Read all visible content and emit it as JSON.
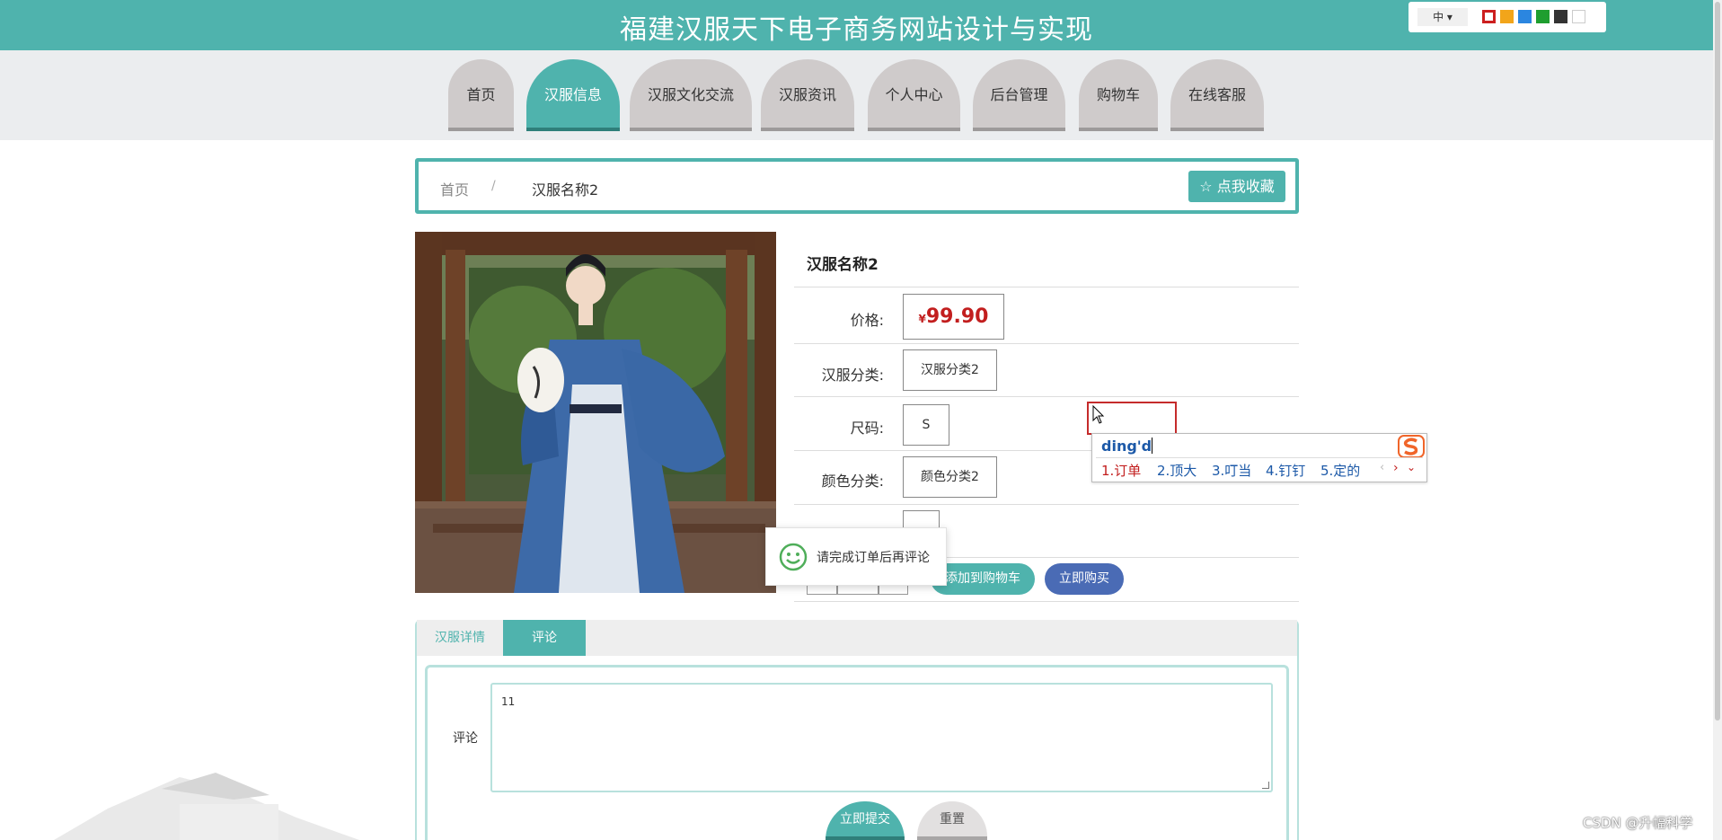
{
  "header": {
    "title": "福建汉服天下电子商务网站设计与实现",
    "language": "中",
    "theme_swatches": [
      "#cc1f1f",
      "#f2a51a",
      "#2b86e0",
      "#1f9e2f",
      "#333333",
      "#ffffff"
    ]
  },
  "nav": {
    "items": [
      {
        "label": "首页"
      },
      {
        "label": "汉服信息"
      },
      {
        "label": "汉服文化交流"
      },
      {
        "label": "汉服资讯"
      },
      {
        "label": "个人中心"
      },
      {
        "label": "后台管理"
      },
      {
        "label": "购物车"
      },
      {
        "label": "在线客服"
      }
    ],
    "active_index": 1
  },
  "breadcrumb": {
    "home": "首页",
    "separator": "/",
    "current": "汉服名称2",
    "collect_label": "☆ 点我收藏"
  },
  "product": {
    "name": "汉服名称2",
    "price_label": "价格:",
    "currency": "¥",
    "price": "99.90",
    "category_label": "汉服分类:",
    "category": "汉服分类2",
    "size_label": "尺码:",
    "size": "S",
    "color_label": "颜色分类:",
    "color": "颜色分类2",
    "add_to_cart": "添加到购物车",
    "buy_now": "立即购买"
  },
  "toast": {
    "message": "请完成订单后再评论"
  },
  "ime": {
    "input": "ding'd",
    "candidates": [
      "1.订单",
      "2.顶大",
      "3.叮当",
      "4.钉钉",
      "5.定的"
    ]
  },
  "tabs": {
    "detail": "汉服详情",
    "comment": "评论"
  },
  "comment_form": {
    "label": "评论",
    "value": "11",
    "submit": "立即提交",
    "reset": "重置"
  },
  "watermark": "CSDN @升幅科学"
}
